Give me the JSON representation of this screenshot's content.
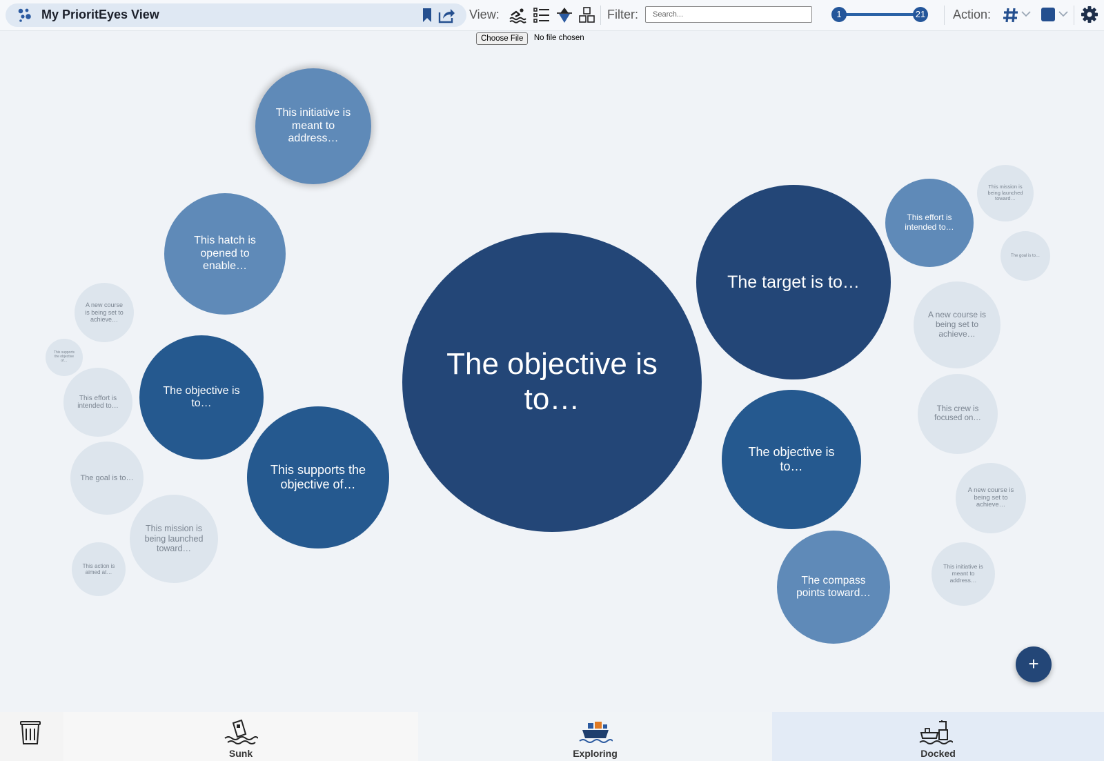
{
  "app": {
    "title": "My PrioritEyes View"
  },
  "toolbar": {
    "view_label": "View:",
    "filter_label": "Filter:",
    "search_placeholder": "Search...",
    "range_min": "1",
    "range_max": "21",
    "action_label": "Action:",
    "accent_color": "#244f8f"
  },
  "file": {
    "button_label": "Choose File",
    "status": "No file chosen"
  },
  "bubbles": [
    {
      "text": "This initiative is meant to address…"
    },
    {
      "text": "This hatch is opened to enable…"
    },
    {
      "text": "A new course is being set to achieve…"
    },
    {
      "text": "This supports the objective of…"
    },
    {
      "text": "The objective is to…"
    },
    {
      "text": "This effort is intended to…"
    },
    {
      "text": "The goal is to…"
    },
    {
      "text": "This mission is being launched toward…"
    },
    {
      "text": "This action is aimed at…"
    },
    {
      "text": "This supports the objective of…"
    },
    {
      "text": "The objective is to…"
    },
    {
      "text": "The target is to…"
    },
    {
      "text": "The objective is to…"
    },
    {
      "text": "The compass points toward…"
    },
    {
      "text": "This effort is intended to…"
    },
    {
      "text": "This mission is being launched toward…"
    },
    {
      "text": "The goal is to…"
    },
    {
      "text": "A new course is being set to achieve…"
    },
    {
      "text": "This crew is focused on…"
    },
    {
      "text": "A new course is being set to achieve…"
    },
    {
      "text": "This initiative is meant to address…"
    }
  ],
  "zones": {
    "sunk": "Sunk",
    "exploring": "Exploring",
    "docked": "Docked"
  },
  "add_button": "+"
}
